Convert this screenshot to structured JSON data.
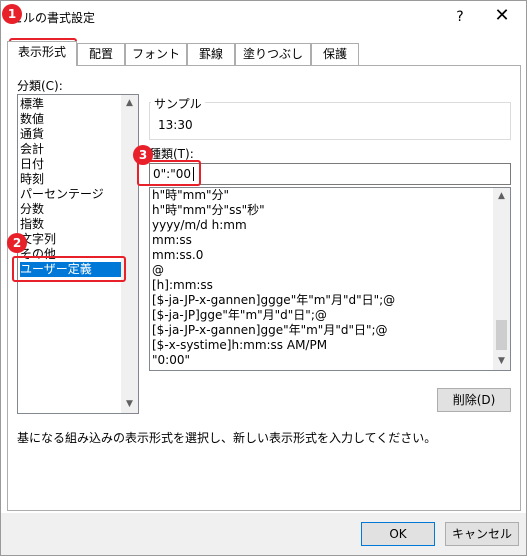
{
  "window": {
    "title": "セルの書式設定",
    "help_glyph": "?",
    "close_glyph": "✕"
  },
  "tabs": [
    {
      "label": "表示形式",
      "active": true
    },
    {
      "label": "配置"
    },
    {
      "label": "フォント"
    },
    {
      "label": "罫線"
    },
    {
      "label": "塗りつぶし"
    },
    {
      "label": "保護"
    }
  ],
  "category": {
    "label": "分類(C):",
    "items": [
      "標準",
      "数値",
      "通貨",
      "会計",
      "日付",
      "時刻",
      "パーセンテージ",
      "分数",
      "指数",
      "文字列",
      "その他",
      "ユーザー定義"
    ],
    "selected": "ユーザー定義"
  },
  "sample": {
    "label": "サンプル",
    "value": "13:30"
  },
  "type": {
    "label": "種類(T):",
    "input_value": "0\":\"00",
    "items": [
      "h\"時\"mm\"分\"",
      "h\"時\"mm\"分\"ss\"秒\"",
      "yyyy/m/d h:mm",
      "mm:ss",
      "mm:ss.0",
      "@",
      "[h]:mm:ss",
      "[$-ja-JP-x-gannen]ggge\"年\"m\"月\"d\"日\";@",
      "[$-ja-JP]gge\"年\"m\"月\"d\"日\";@",
      "[$-ja-JP-x-gannen]gge\"年\"m\"月\"d\"日\";@",
      "[$-x-systime]h:mm:ss AM/PM",
      "\"0:00\""
    ]
  },
  "delete_button": "削除(D)",
  "description": "基になる組み込みの表示形式を選択し、新しい表示形式を入力してください。",
  "ok_button": "OK",
  "cancel_button": "キャンセル",
  "scroll": {
    "up_glyph": "▲",
    "down_glyph": "▼"
  },
  "annotations": {
    "badge_1": "1",
    "badge_2": "2",
    "badge_3": "3",
    "color": "#e8202a"
  }
}
